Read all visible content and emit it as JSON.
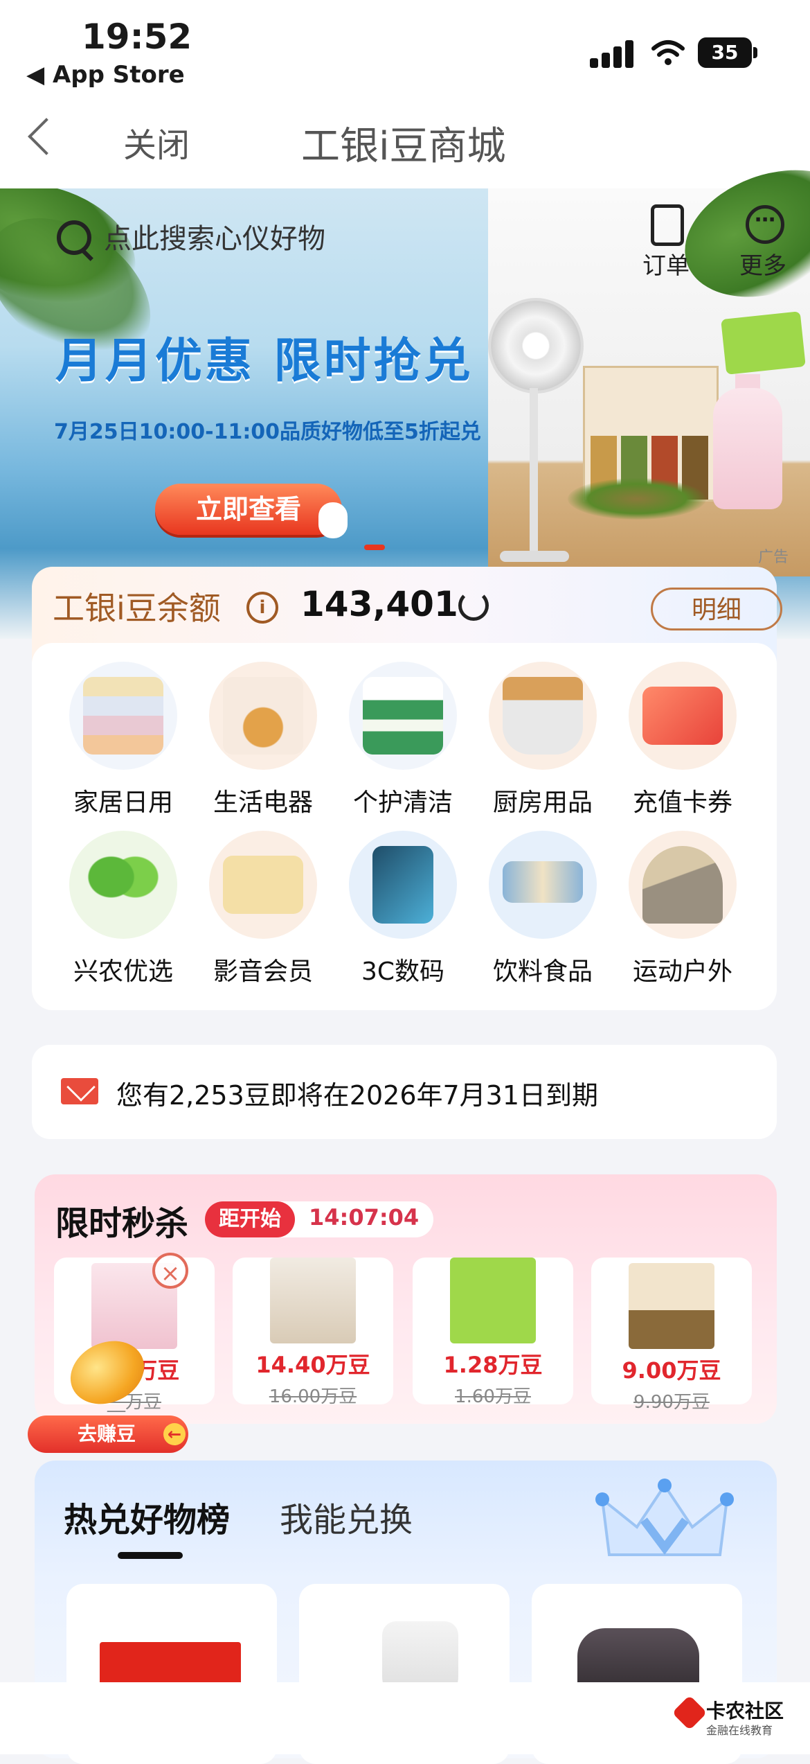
{
  "status_bar": {
    "time": "19:52",
    "back_app": "App Store",
    "battery": "35"
  },
  "nav": {
    "close_label": "关闭",
    "title": "工银i豆商城"
  },
  "banner": {
    "search_placeholder": "点此搜索心仪好物",
    "order_label": "订单",
    "more_label": "更多",
    "headline": "月月优惠 限时抢兑",
    "subline": "7月25日10:00-11:00品质好物低至5折起兑",
    "cta": "立即查看",
    "ad_tag": "广告"
  },
  "balance": {
    "label": "工银i豆余额",
    "value": "143,401",
    "detail_button": "明细"
  },
  "categories": [
    {
      "label": "家居日用",
      "icon": "towels-icon"
    },
    {
      "label": "生活电器",
      "icon": "kettle-icon"
    },
    {
      "label": "个护清洁",
      "icon": "tissue-icon"
    },
    {
      "label": "厨房用品",
      "icon": "pot-icon"
    },
    {
      "label": "充值卡券",
      "icon": "voucher-icon"
    },
    {
      "label": "兴农优选",
      "icon": "sprout-icon"
    },
    {
      "label": "影音会员",
      "icon": "membership-card-icon"
    },
    {
      "label": "3C数码",
      "icon": "smartphone-icon"
    },
    {
      "label": "饮料食品",
      "icon": "drinks-icon"
    },
    {
      "label": "运动户外",
      "icon": "tent-icon"
    }
  ],
  "notice": {
    "text": "您有2,253豆即将在2026年7月31日到期"
  },
  "flash_sale": {
    "title": "限时秒杀",
    "countdown_label": "距开始",
    "countdown": "14:07:04",
    "items": [
      {
        "price": "1.__万豆",
        "original": "__万豆"
      },
      {
        "price": "14.40万豆",
        "original": "16.00万豆"
      },
      {
        "price": "1.28万豆",
        "original": "1.60万豆"
      },
      {
        "price": "9.00万豆",
        "original": "9.90万豆"
      }
    ],
    "earn_button": "去赚豆"
  },
  "ranking": {
    "tab_active": "热兑好物榜",
    "tab_other": "我能兑换"
  },
  "watermark": {
    "name": "卡农社区",
    "sub": "金融在线教育"
  },
  "colors": {
    "accent_red": "#e1262d",
    "balance_brown": "#a05a24",
    "banner_blue": "#1a7bd6"
  }
}
